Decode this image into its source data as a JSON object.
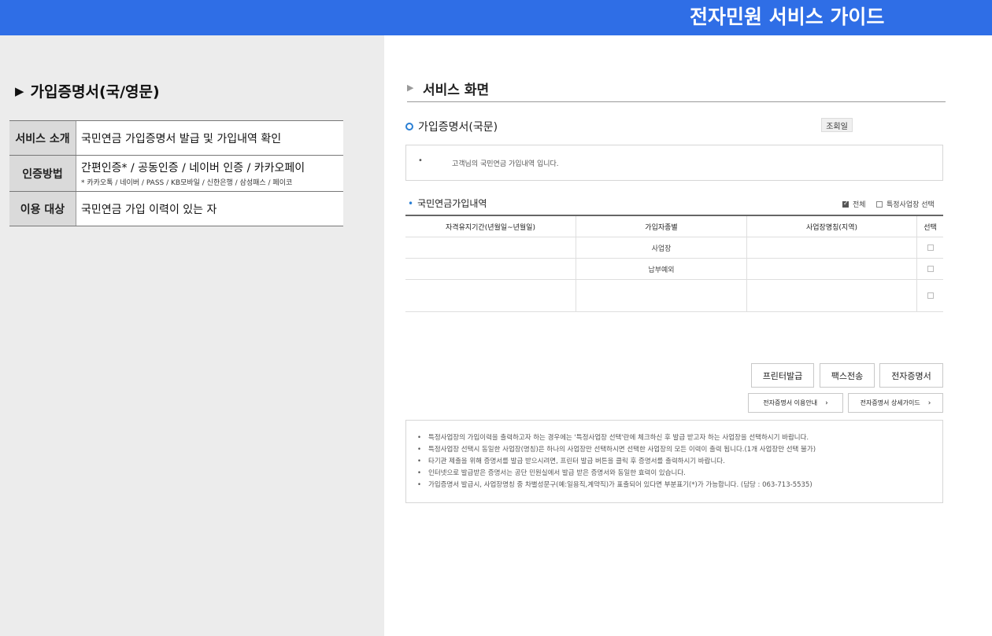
{
  "header": {
    "title": "전자민원 서비스 가이드"
  },
  "left": {
    "heading": "가입증명서(국/영문)",
    "heading_icon": "triangle-right-icon",
    "rows": [
      {
        "key": "서비스 소개",
        "value": "국민연금 가입증명서 발급 및 가입내역 확인",
        "sub": ""
      },
      {
        "key": "인증방법",
        "value": "간편인증* / 공동인증 / 네이버 인증 / 카카오페이",
        "sub": "* 카카오톡 / 네이버 / PASS / KB모바일 / 신한은행 / 삼성패스 / 페이코"
      },
      {
        "key": "이용 대상",
        "value": "국민연금 가입 이력이 있는 자",
        "sub": ""
      }
    ]
  },
  "main": {
    "section_title": "서비스 화면",
    "cert_title": "가입증명서(국문)",
    "date_badge": "조회일",
    "notice": {
      "bullet": "•",
      "text": "고객님의 국민연금 가입내역 입니다."
    },
    "list": {
      "title": "국민연금가입내역",
      "filter_all": {
        "label": "전체",
        "checked": true
      },
      "filter_specific": {
        "label": "특정사업장 선택",
        "checked": false
      },
      "columns": [
        "자격유지기간(년월일~년월일)",
        "가입자종별",
        "사업장명칭(지역)",
        "선택"
      ],
      "rows": [
        {
          "period": "",
          "type": "사업장",
          "workplace": ""
        },
        {
          "period": "",
          "type": "납부예외",
          "workplace": ""
        },
        {
          "period": "",
          "type": "",
          "workplace": ""
        }
      ]
    },
    "buttons": {
      "printer": "프린터발급",
      "fax": "팩스전송",
      "e_cert": "전자증명서"
    },
    "links": {
      "usage": "전자증명서 이용안내",
      "detail": "전자증명서 상세가이드",
      "chevron": "›"
    },
    "guide": [
      "특정사업장의 가입이력을 출력하고자 하는 경우에는 '특정사업장 선택'란에 체크하신 후 발급 받고자 하는 사업장을 선택하시기 바랍니다.",
      "특정사업장 선택시 동일한 사업장(명칭)은 하나의 사업장만 선택하시면 선택한 사업장의 모든 이력이 출력 됩니다.(1개 사업장만 선택 불가)",
      "타기관 제출을 위해 증명서를 발급 받으시려면, 프린터 발급 버튼을 클릭 후 증명서를 출력하시기 바랍니다.",
      "인터넷으로 발급받은 증명서는 공단 민원실에서 발급 받은 증명서와 동일한 효력이 있습니다.",
      "가입증명서 발급시, 사업장명칭 중 차별성문구(예:일용직,계약직)가 표출되어 있다면 부분표기(*)가 가능합니다. (담당 : 063-713-5535)"
    ],
    "guide_bullet": "•"
  },
  "colors": {
    "header_bg": "#2f6ee6",
    "accent_blue": "#2a7fd4",
    "left_bg": "#ececec"
  }
}
